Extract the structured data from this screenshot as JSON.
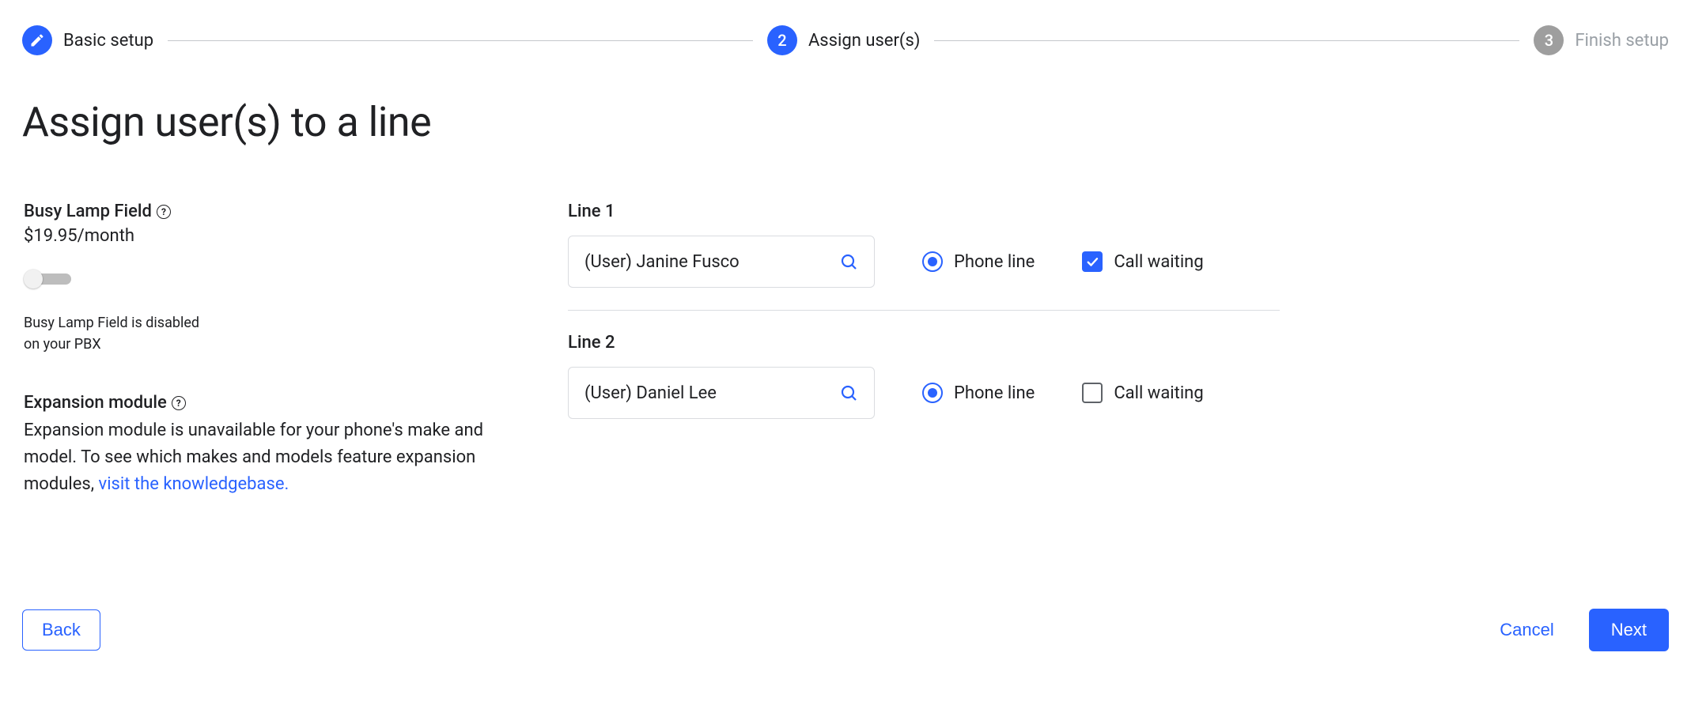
{
  "stepper": [
    {
      "label": "Basic setup",
      "state": "done",
      "badge": "pencil"
    },
    {
      "label": "Assign user(s)",
      "state": "active",
      "badge": "2"
    },
    {
      "label": "Finish setup",
      "state": "future",
      "badge": "3"
    }
  ],
  "title": "Assign user(s) to a line",
  "busy_lamp": {
    "heading": "Busy Lamp Field",
    "price": "$19.95/month",
    "enabled": false,
    "note": "Busy Lamp Field is disabled\non your PBX"
  },
  "expansion": {
    "heading": "Expansion module",
    "text": "Expansion module is unavailable for your phone's make and model. To see which makes and models feature expansion modules, ",
    "link_text": "visit the knowledgebase."
  },
  "lines": [
    {
      "label": "Line 1",
      "user": "(User) Janine Fusco",
      "radio_label": "Phone line",
      "radio_selected": true,
      "checkbox_label": "Call waiting",
      "checkbox_checked": true
    },
    {
      "label": "Line 2",
      "user": "(User) Daniel Lee",
      "radio_label": "Phone line",
      "radio_selected": true,
      "checkbox_label": "Call waiting",
      "checkbox_checked": false
    }
  ],
  "buttons": {
    "back": "Back",
    "cancel": "Cancel",
    "next": "Next"
  }
}
